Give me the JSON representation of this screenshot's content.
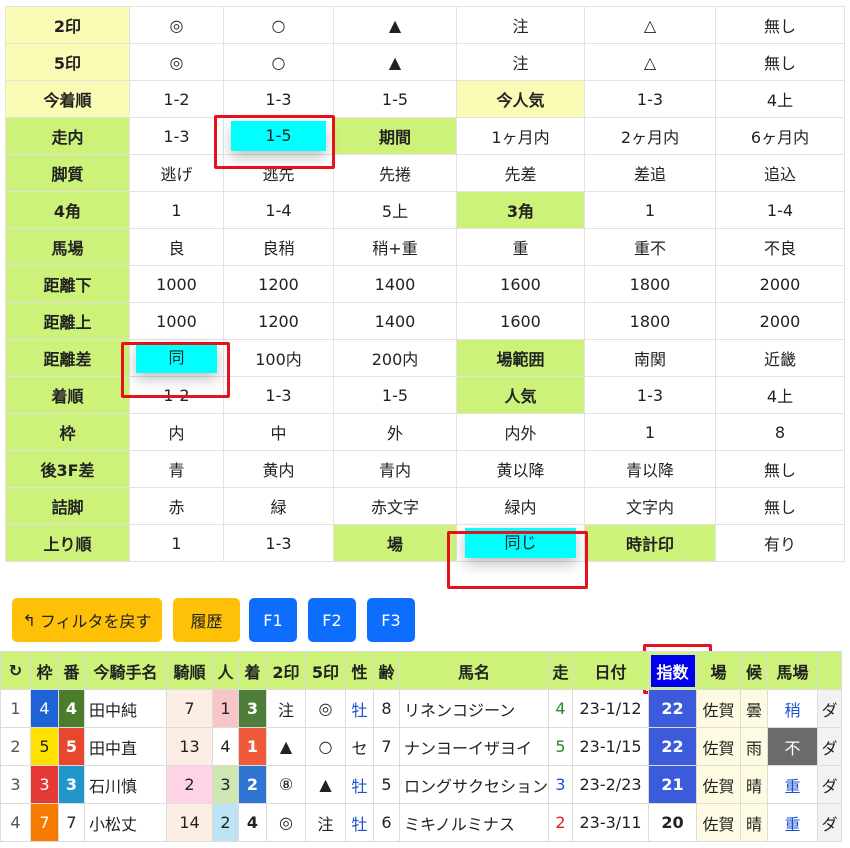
{
  "filter_rows": [
    {
      "cells": [
        {
          "t": "2印",
          "k": "lbl-y"
        },
        {
          "t": "◎"
        },
        {
          "t": "○"
        },
        {
          "t": "▲"
        },
        {
          "t": "注"
        },
        {
          "t": "△"
        },
        {
          "t": "無し"
        }
      ]
    },
    {
      "cells": [
        {
          "t": "5印",
          "k": "lbl-y"
        },
        {
          "t": "◎"
        },
        {
          "t": "○"
        },
        {
          "t": "▲"
        },
        {
          "t": "注"
        },
        {
          "t": "△"
        },
        {
          "t": "無し"
        }
      ]
    },
    {
      "cells": [
        {
          "t": "今着順",
          "k": "lbl-y"
        },
        {
          "t": "1-2"
        },
        {
          "t": "1-3"
        },
        {
          "t": "1-5"
        },
        {
          "t": "今人気",
          "k": "lbl-y"
        },
        {
          "t": "1-3"
        },
        {
          "t": "4上"
        }
      ]
    },
    {
      "cells": [
        {
          "t": "走内",
          "k": "lbl"
        },
        {
          "t": "1-3"
        },
        {
          "t": "1-5",
          "sel": true
        },
        {
          "t": "期間",
          "k": "lbl"
        },
        {
          "t": "1ヶ月内"
        },
        {
          "t": "2ヶ月内"
        },
        {
          "t": "6ヶ月内"
        }
      ]
    },
    {
      "cells": [
        {
          "t": "脚質",
          "k": "lbl"
        },
        {
          "t": "逃げ"
        },
        {
          "t": "逃先"
        },
        {
          "t": "先捲"
        },
        {
          "t": "先差"
        },
        {
          "t": "差追"
        },
        {
          "t": "追込"
        }
      ]
    },
    {
      "cells": [
        {
          "t": "4角",
          "k": "lbl"
        },
        {
          "t": "1"
        },
        {
          "t": "1-4"
        },
        {
          "t": "5上"
        },
        {
          "t": "3角",
          "k": "lbl"
        },
        {
          "t": "1"
        },
        {
          "t": "1-4"
        }
      ]
    },
    {
      "cells": [
        {
          "t": "馬場",
          "k": "lbl"
        },
        {
          "t": "良"
        },
        {
          "t": "良稍"
        },
        {
          "t": "稍+重"
        },
        {
          "t": "重"
        },
        {
          "t": "重不"
        },
        {
          "t": "不良"
        }
      ]
    },
    {
      "cells": [
        {
          "t": "距離下",
          "k": "lbl"
        },
        {
          "t": "1000"
        },
        {
          "t": "1200"
        },
        {
          "t": "1400"
        },
        {
          "t": "1600"
        },
        {
          "t": "1800"
        },
        {
          "t": "2000"
        }
      ]
    },
    {
      "cells": [
        {
          "t": "距離上",
          "k": "lbl"
        },
        {
          "t": "1000"
        },
        {
          "t": "1200"
        },
        {
          "t": "1400"
        },
        {
          "t": "1600"
        },
        {
          "t": "1800"
        },
        {
          "t": "2000"
        }
      ]
    },
    {
      "cells": [
        {
          "t": "距離差",
          "k": "lbl"
        },
        {
          "t": "同",
          "sel": true
        },
        {
          "t": "100内"
        },
        {
          "t": "200内"
        },
        {
          "t": "場範囲",
          "k": "lbl"
        },
        {
          "t": "南関"
        },
        {
          "t": "近畿"
        }
      ]
    },
    {
      "cells": [
        {
          "t": "着順",
          "k": "lbl"
        },
        {
          "t": "1-2"
        },
        {
          "t": "1-3"
        },
        {
          "t": "1-5"
        },
        {
          "t": "人気",
          "k": "lbl"
        },
        {
          "t": "1-3"
        },
        {
          "t": "4上"
        }
      ]
    },
    {
      "cells": [
        {
          "t": "枠",
          "k": "lbl"
        },
        {
          "t": "内"
        },
        {
          "t": "中"
        },
        {
          "t": "外"
        },
        {
          "t": "内外"
        },
        {
          "t": "1"
        },
        {
          "t": "8"
        }
      ]
    },
    {
      "cells": [
        {
          "t": "後3F差",
          "k": "lbl"
        },
        {
          "t": "青"
        },
        {
          "t": "黄内"
        },
        {
          "t": "青内"
        },
        {
          "t": "黄以降"
        },
        {
          "t": "青以降"
        },
        {
          "t": "無し"
        }
      ]
    },
    {
      "cells": [
        {
          "t": "詰脚",
          "k": "lbl"
        },
        {
          "t": "赤"
        },
        {
          "t": "緑"
        },
        {
          "t": "赤文字"
        },
        {
          "t": "緑内"
        },
        {
          "t": "文字内"
        },
        {
          "t": "無し"
        }
      ]
    },
    {
      "cells": [
        {
          "t": "上り順",
          "k": "lbl"
        },
        {
          "t": "1"
        },
        {
          "t": "1-3"
        },
        {
          "t": "場",
          "k": "lbl"
        },
        {
          "t": "同じ",
          "sel": true
        },
        {
          "t": "時計印",
          "k": "lbl"
        },
        {
          "t": "有り"
        }
      ]
    }
  ],
  "buttons": {
    "reset": "フィルタを戻す",
    "history": "履歴",
    "f1": "F1",
    "f2": "F2",
    "f3": "F3"
  },
  "results": {
    "headers": [
      "↻",
      "枠",
      "番",
      "今騎手名",
      "騎順",
      "人",
      "着",
      "2印",
      "5印",
      "性",
      "齢",
      "馬名",
      "走",
      "日付",
      "指数",
      "場",
      "候",
      "馬場",
      ""
    ],
    "rows": [
      {
        "no": "1",
        "waku": "4",
        "ban": "4",
        "jockey": "田中純",
        "kijun": "7",
        "nin": "1",
        "chaku": "3",
        "m2": "注",
        "m5": "◎",
        "sex": "牡",
        "age": "8",
        "horse": "リネンコジーン",
        "sou": "4",
        "date": "23-1/12",
        "idx": "22",
        "ba": "佐賀",
        "kou": "曇",
        "baba": "稍",
        "x": "ダ"
      },
      {
        "no": "2",
        "waku": "5",
        "ban": "5",
        "jockey": "田中直",
        "kijun": "13",
        "nin": "4",
        "chaku": "1",
        "m2": "▲",
        "m5": "○",
        "sex": "セ",
        "age": "7",
        "horse": "ナンヨーイザヨイ",
        "sou": "5",
        "date": "23-1/15",
        "idx": "22",
        "ba": "佐賀",
        "kou": "雨",
        "baba": "不",
        "x": "ダ"
      },
      {
        "no": "3",
        "waku": "3",
        "ban": "3",
        "jockey": "石川慎",
        "kijun": "2",
        "nin": "3",
        "chaku": "2",
        "m2": "⑧",
        "m5": "▲",
        "sex": "牡",
        "age": "5",
        "horse": "ロングサクセション",
        "sou": "3",
        "date": "23-2/23",
        "idx": "21",
        "ba": "佐賀",
        "kou": "晴",
        "baba": "重",
        "x": "ダ"
      },
      {
        "no": "4",
        "waku": "7",
        "ban": "7",
        "jockey": "小松丈",
        "kijun": "14",
        "nin": "2",
        "chaku": "4",
        "m2": "◎",
        "m5": "注",
        "sex": "牡",
        "age": "6",
        "horse": "ミキノルミナス",
        "sou": "2",
        "date": "23-3/11",
        "idx": "20",
        "ba": "佐賀",
        "kou": "晴",
        "baba": "重",
        "x": "ダ"
      }
    ]
  },
  "colors": {
    "accent_green": "#cdf27a",
    "accent_yellow": "#fafbb4",
    "selected": "#00ffff",
    "highlight_box": "#e5121b",
    "button_yellow": "#ffc107",
    "button_blue": "#0d6efd"
  }
}
